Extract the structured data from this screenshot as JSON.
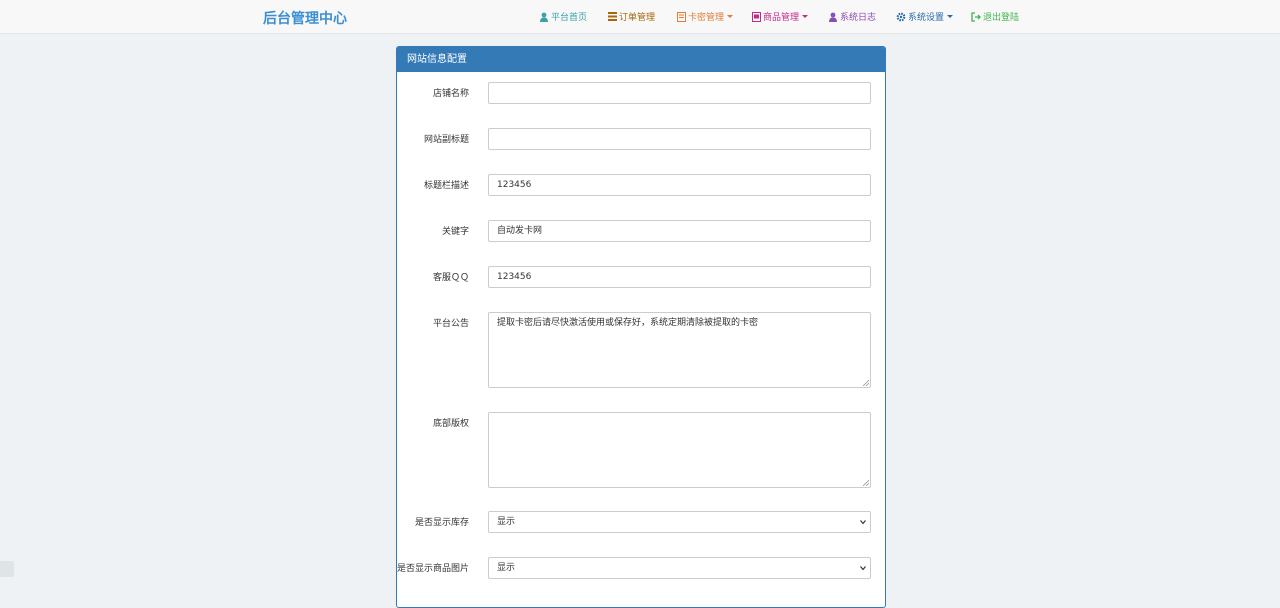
{
  "brand": "后台管理中心",
  "nav": {
    "home": {
      "label": "平台首页",
      "color": "#3aa1a8",
      "icon": "user-icon"
    },
    "orders": {
      "label": "订单管理",
      "color": "#a8650a",
      "icon": "list-icon"
    },
    "cards": {
      "label": "卡密管理",
      "color": "#e07b39",
      "icon": "card-icon"
    },
    "products": {
      "label": "商品管理",
      "color": "#c22b8c",
      "icon": "product-icon"
    },
    "logs": {
      "label": "系统日志",
      "color": "#8c4bb5",
      "icon": "user-icon"
    },
    "settings": {
      "label": "系统设置",
      "color": "#2a6aa8",
      "icon": "gear-icon"
    },
    "logout": {
      "label": "退出登陆",
      "color": "#3fb34f",
      "icon": "logout-icon"
    }
  },
  "panel": {
    "title": "网站信息配置",
    "fields": {
      "shop_name": {
        "label": "店铺名称",
        "value": ""
      },
      "subtitle": {
        "label": "网站副标题",
        "value": ""
      },
      "title_desc": {
        "label": "标题栏描述",
        "value": "123456"
      },
      "keywords": {
        "label": "关键字",
        "value": "自动发卡网"
      },
      "qq": {
        "label": "客服ＱＱ",
        "value": "123456"
      },
      "notice": {
        "label": "平台公告",
        "value": "提取卡密后请尽快激活使用或保存好，系统定期清除被提取的卡密"
      },
      "copyright": {
        "label": "底部版权",
        "value": ""
      },
      "show_stock": {
        "label": "是否显示库存",
        "value": "显示"
      },
      "show_image": {
        "label": "是否显示商品图片",
        "value": "显示"
      }
    }
  }
}
